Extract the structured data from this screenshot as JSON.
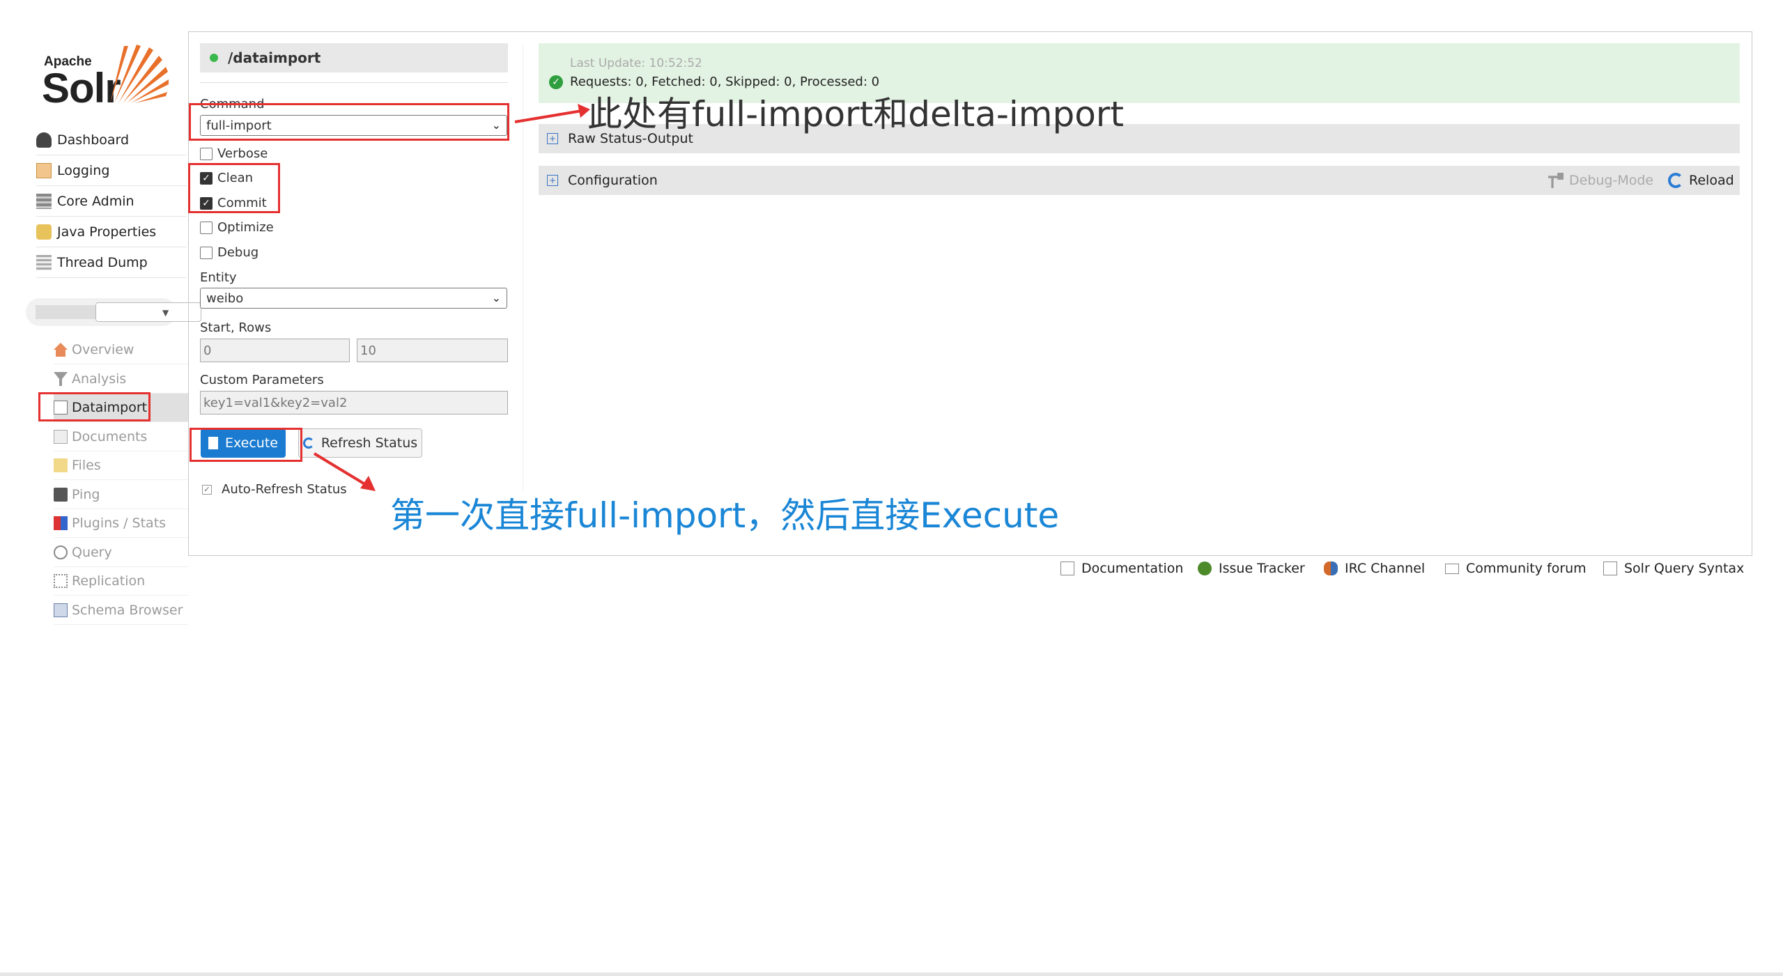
{
  "logo": {
    "apache": "Apache",
    "solr": "Solr"
  },
  "sidebar": {
    "items": [
      {
        "label": "Dashboard",
        "icon": "dashboard-icon"
      },
      {
        "label": "Logging",
        "icon": "logging-icon"
      },
      {
        "label": "Core Admin",
        "icon": "core-admin-icon"
      },
      {
        "label": "Java Properties",
        "icon": "java-icon"
      },
      {
        "label": "Thread Dump",
        "icon": "thread-dump-icon"
      }
    ],
    "core_items": [
      {
        "label": "Overview",
        "icon": "overview-icon"
      },
      {
        "label": "Analysis",
        "icon": "analysis-icon"
      },
      {
        "label": "Dataimport",
        "icon": "dataimport-icon"
      },
      {
        "label": "Documents",
        "icon": "documents-icon"
      },
      {
        "label": "Files",
        "icon": "files-icon"
      },
      {
        "label": "Ping",
        "icon": "ping-icon"
      },
      {
        "label": "Plugins / Stats",
        "icon": "plugins-icon"
      },
      {
        "label": "Query",
        "icon": "query-icon"
      },
      {
        "label": "Replication",
        "icon": "replication-icon"
      },
      {
        "label": "Schema Browser",
        "icon": "schema-icon"
      }
    ]
  },
  "form": {
    "handler": "/dataimport",
    "command_label": "Command",
    "command_value": "full-import",
    "checkboxes": [
      {
        "label": "Verbose",
        "checked": false
      },
      {
        "label": "Clean",
        "checked": true
      },
      {
        "label": "Commit",
        "checked": true
      },
      {
        "label": "Optimize",
        "checked": false
      },
      {
        "label": "Debug",
        "checked": false
      }
    ],
    "entity_label": "Entity",
    "entity_value": "weibo",
    "start_rows_label": "Start, Rows",
    "start_placeholder": "0",
    "rows_placeholder": "10",
    "custom_params_label": "Custom Parameters",
    "custom_params_placeholder": "key1=val1&key2=val2",
    "execute_label": "Execute",
    "refresh_label": "Refresh Status",
    "auto_refresh_label": "Auto-Refresh Status"
  },
  "status": {
    "last_update": "Last Update: 10:52:52",
    "requests": "Requests: 0, Fetched: 0, Skipped: 0, Processed: 0",
    "raw_status_label": "Raw Status-Output",
    "configuration_label": "Configuration",
    "debug_mode_label": "Debug-Mode",
    "reload_label": "Reload"
  },
  "footer": [
    {
      "label": "Documentation",
      "icon": "documentation-icon"
    },
    {
      "label": "Issue Tracker",
      "icon": "bug-icon"
    },
    {
      "label": "IRC Channel",
      "icon": "irc-icon"
    },
    {
      "label": "Community forum",
      "icon": "mail-icon"
    },
    {
      "label": "Solr Query Syntax",
      "icon": "syntax-icon"
    }
  ],
  "annotations": {
    "command_note": "此处有full-import和delta-import",
    "execute_note": "第一次直接full-import，然后直接Execute"
  },
  "colors": {
    "annotation_red": "#e53030",
    "annotation_blue": "#1a86d6",
    "execute_blue": "#1a7bd1",
    "status_green": "#e3f3e3"
  }
}
